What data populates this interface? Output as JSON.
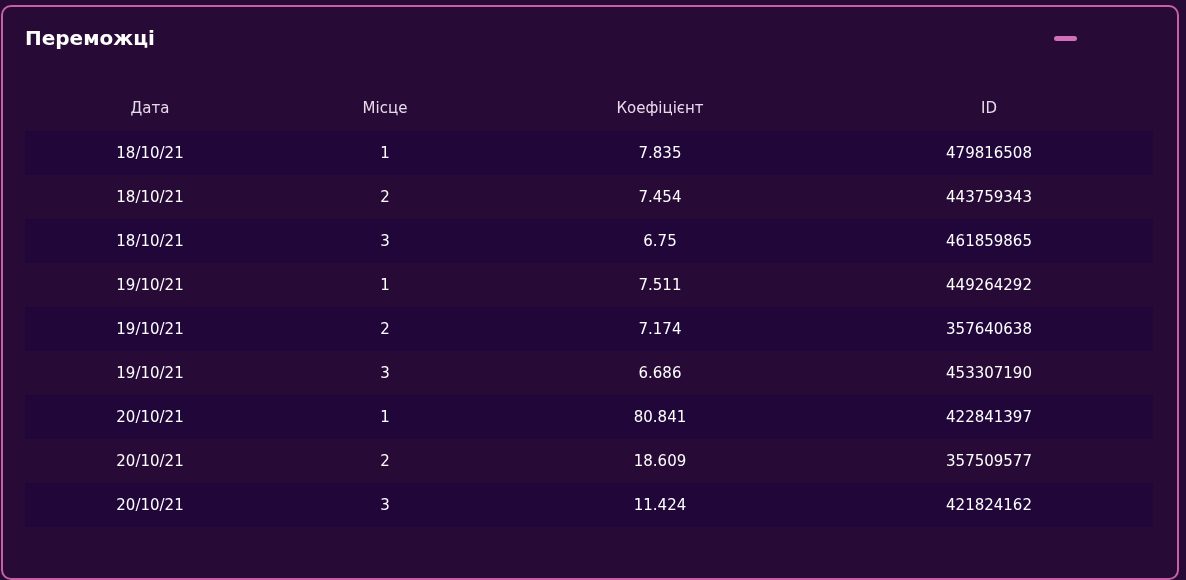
{
  "panel": {
    "title": "Переможці",
    "collapse_button": {
      "expanded": true
    }
  },
  "table": {
    "columns": [
      "Дата",
      "Місце",
      "Коефіцієнт",
      "ID"
    ],
    "rows": [
      [
        "18/10/21",
        "1",
        "7.835",
        "479816508"
      ],
      [
        "18/10/21",
        "2",
        "7.454",
        "443759343"
      ],
      [
        "18/10/21",
        "3",
        "6.75",
        "461859865"
      ],
      [
        "19/10/21",
        "1",
        "7.511",
        "449264292"
      ],
      [
        "19/10/21",
        "2",
        "7.174",
        "357640638"
      ],
      [
        "19/10/21",
        "3",
        "6.686",
        "453307190"
      ],
      [
        "20/10/21",
        "1",
        "80.841",
        "422841397"
      ],
      [
        "20/10/21",
        "2",
        "18.609",
        "357509577"
      ],
      [
        "20/10/21",
        "3",
        "11.424",
        "421824162"
      ]
    ]
  }
}
